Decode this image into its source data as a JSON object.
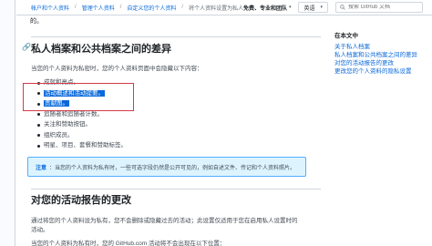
{
  "breadcrumb": {
    "items": [
      "帐户和个人资料",
      "管理个人资料",
      "自定义您的个人资料",
      "将个人资料设置为私人"
    ]
  },
  "header": {
    "nav_menu_label": "免费、专业和团队",
    "language_label": "英语",
    "search_placeholder": "搜索 GitHub 文档"
  },
  "article": {
    "top_snippet": "的。",
    "section1": {
      "heading": "私人档案和公共档案之间的差异",
      "intro": "当您的个人资料为私密时，您的个人资料页面中会隐藏以下内容：",
      "items": [
        "成就和亮点。",
        "活动概述和活动提要。",
        "贡献图。",
        "追随者和追随者计数。",
        "关注和赞助按钮。",
        "组织成员。",
        "明星、项目、套餐和赞助标签。"
      ],
      "highlighted_items": [
        "活动概述和活动提要。",
        "贡献图。"
      ],
      "note_label": "注意",
      "note_text": "：当您的个人资料为私有时，一些可选字段仍然是公开可见的，例如自述文件、传记和个人资料照片。"
    },
    "section2": {
      "heading": "对您的活动报告的更改",
      "para1_line1": "通过将您的个人资料设为私有，您不会删除或隐藏过去的活动；此设置仅适用于您在启用私人设置时的",
      "para1_line2": "活动。",
      "para2": "当您的个人资料为私有时，您的 GitHub.com 活动将不会出现在以下位置："
    }
  },
  "toc": {
    "title": "在本文中",
    "items": [
      "关于私人档案",
      "私人档案和公共档案之间的差异",
      "对您的活动报告的更改",
      "更改您的个人资料的隐私设置"
    ]
  },
  "colors": {
    "link": "#0969da",
    "highlight": "#0969da",
    "annotation_box": "#d73a49",
    "note_background": "#ddf4ff",
    "note_border": "#54aeff"
  }
}
